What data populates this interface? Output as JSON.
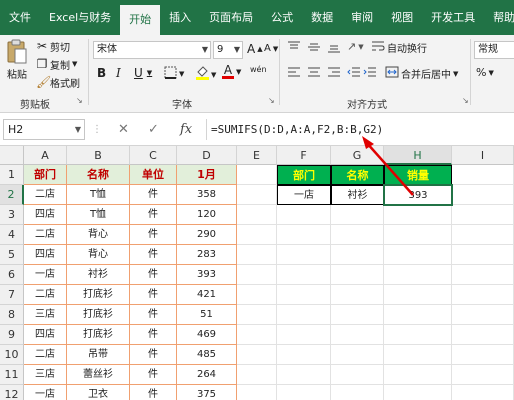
{
  "tabs": [
    "文件",
    "Excel与财务",
    "开始",
    "插入",
    "页面布局",
    "公式",
    "数据",
    "审阅",
    "视图",
    "开发工具",
    "帮助"
  ],
  "active_tab": "开始",
  "ribbon": {
    "clipboard": {
      "paste": "粘贴",
      "cut": "剪切",
      "copy": "复制",
      "format_painter": "格式刷",
      "label": "剪贴板"
    },
    "font": {
      "name": "宋体",
      "size": "9",
      "bold": "B",
      "italic": "I",
      "underline": "U",
      "grow": "A",
      "shrink": "A",
      "font_color_glyph": "A",
      "phonetic": "wén",
      "label": "字体"
    },
    "alignment": {
      "wrap": "自动换行",
      "merge": "合并后居中",
      "label": "对齐方式"
    },
    "number": {
      "format": "常规",
      "percent": "%"
    }
  },
  "formula_bar": {
    "name_box": "H2",
    "cancel": "✕",
    "enter": "✓",
    "fx": "fx",
    "formula": "=SUMIFS(D:D,A:A,F2,B:B,G2)"
  },
  "columns": [
    "A",
    "B",
    "C",
    "D",
    "E",
    "F",
    "G",
    "H",
    "I"
  ],
  "rows": [
    "1",
    "2",
    "3",
    "4",
    "5",
    "6",
    "7",
    "8",
    "9",
    "10",
    "11",
    "12"
  ],
  "table": {
    "headers": [
      "部门",
      "名称",
      "单位",
      "1月"
    ],
    "rows": [
      [
        "二店",
        "T恤",
        "件",
        "358"
      ],
      [
        "四店",
        "T恤",
        "件",
        "120"
      ],
      [
        "二店",
        "背心",
        "件",
        "290"
      ],
      [
        "四店",
        "背心",
        "件",
        "283"
      ],
      [
        "一店",
        "衬衫",
        "件",
        "393"
      ],
      [
        "二店",
        "打底衫",
        "件",
        "421"
      ],
      [
        "三店",
        "打底衫",
        "件",
        "51"
      ],
      [
        "四店",
        "打底衫",
        "件",
        "469"
      ],
      [
        "二店",
        "吊带",
        "件",
        "485"
      ],
      [
        "三店",
        "蕾丝衫",
        "件",
        "264"
      ],
      [
        "一店",
        "卫衣",
        "件",
        "375"
      ]
    ]
  },
  "lookup": {
    "headers": [
      "部门",
      "名称",
      "销量"
    ],
    "row": [
      "一店",
      "衬衫",
      "393"
    ]
  },
  "accent": "#217346"
}
